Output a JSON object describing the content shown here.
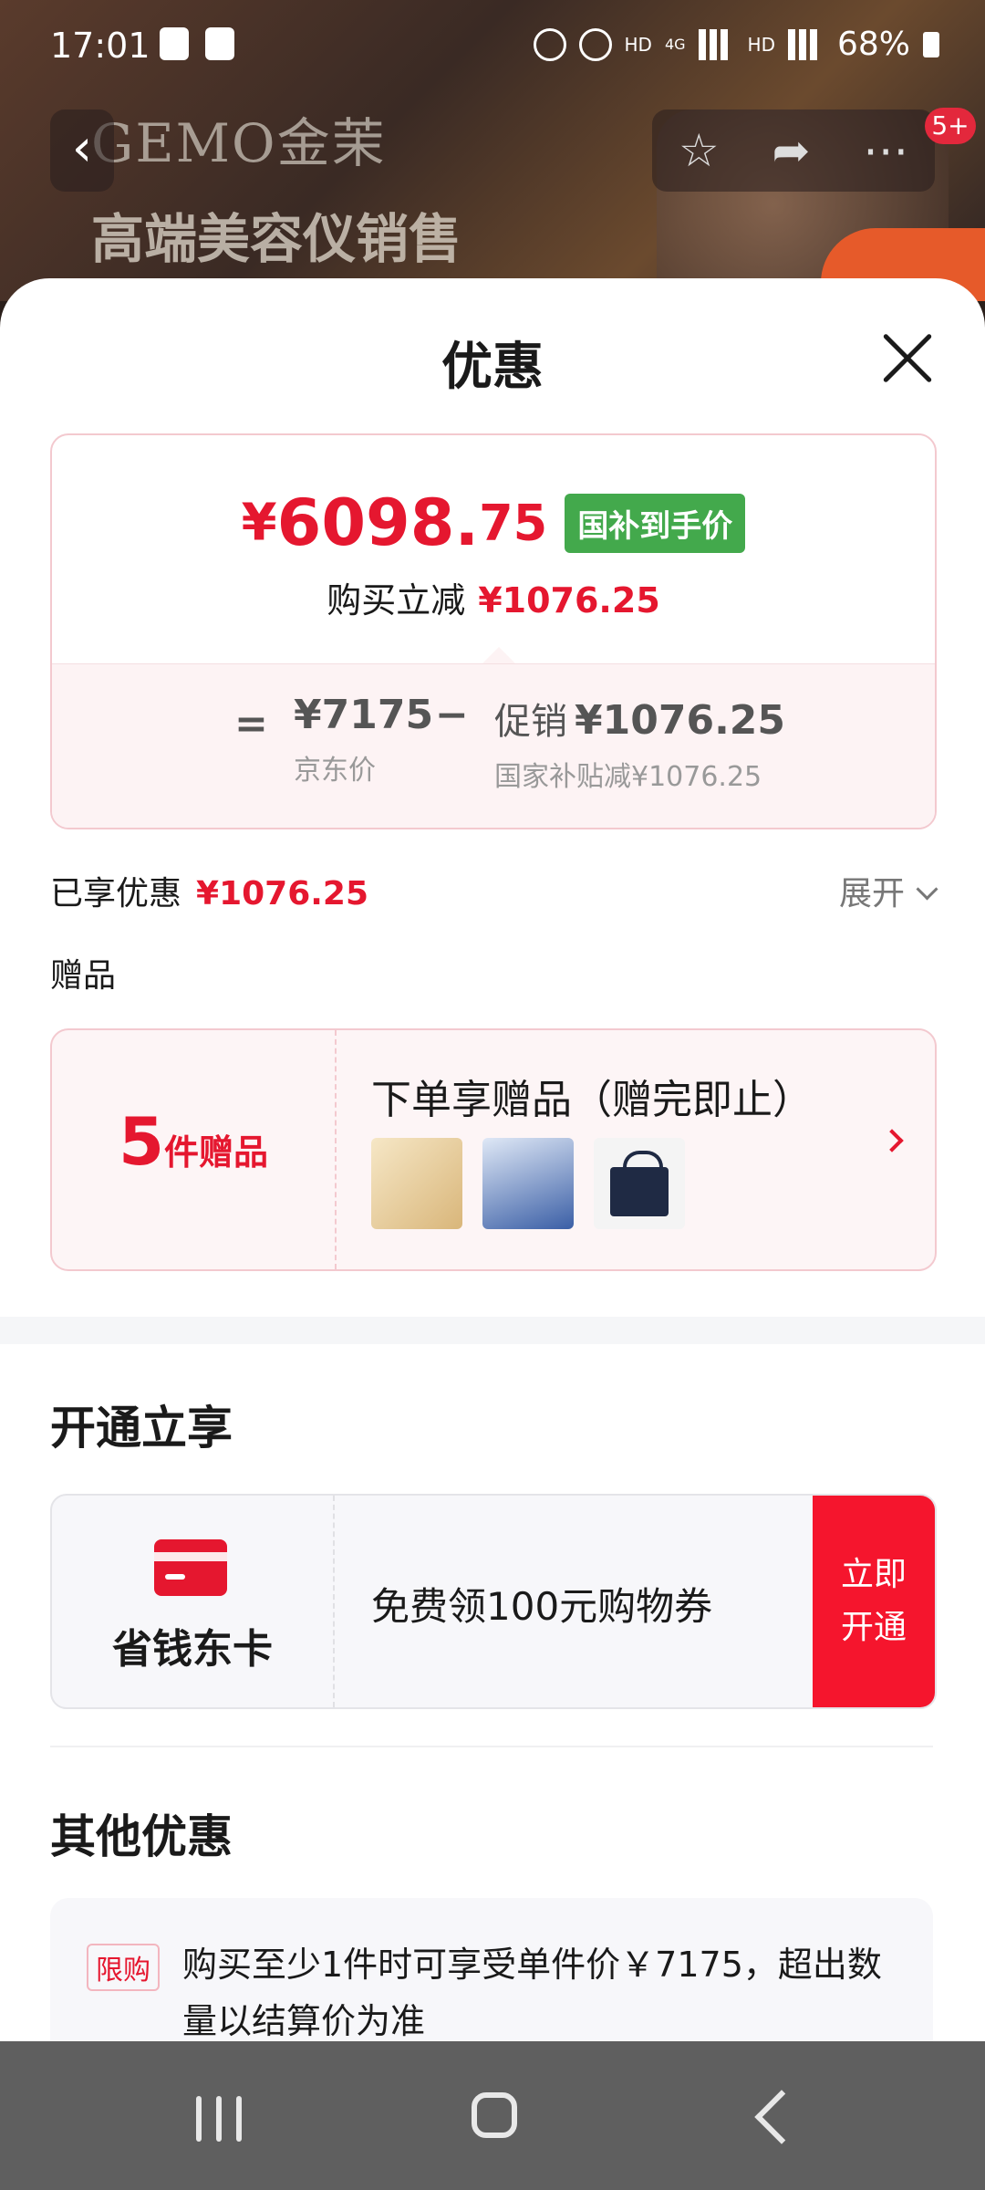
{
  "status_bar": {
    "time": "17:01",
    "net1": "HD",
    "net2": "HD",
    "gen": "4G",
    "battery": "68%"
  },
  "background_page": {
    "brand": "GEMO金茉",
    "subtitle": "高端美容仪销售",
    "badge": "5+"
  },
  "sheet": {
    "title": "优惠"
  },
  "price_card": {
    "currency": "¥",
    "price_int": "6098.",
    "price_dec": "75",
    "tag": "国补到手价",
    "reduce_label": "购买立减",
    "reduce_value": "¥1076.25",
    "equals": "=",
    "base_price": "¥7175",
    "base_label": "京东价",
    "minus": "−",
    "promo_prefix": "促销",
    "promo_value": "¥1076.25",
    "promo_label": "国家补贴减¥1076.25"
  },
  "enjoyed": {
    "label": "已享优惠",
    "value": "¥1076.25",
    "expand": "展开"
  },
  "gifts": {
    "label": "赠品",
    "count": "5",
    "count_unit": "件赠品",
    "title": "下单享赠品（赠完即止）"
  },
  "membership": {
    "section_title": "开通立享",
    "card_name": "省钱东卡",
    "description": "免费领100元购物券",
    "button": "立即开通"
  },
  "other": {
    "section_title": "其他优惠",
    "tag": "限购",
    "text": "购买至少1件时可享受单件价￥7175，超出数量以结算价为准"
  },
  "colors": {
    "accent_red": "#e5172f",
    "tag_green": "#43a94c",
    "nav_bar": "#5f5f5f"
  },
  "icons": [
    "back-icon",
    "star-icon",
    "share-icon",
    "more-icon",
    "close-icon",
    "chevron-down-icon",
    "chevron-right-icon",
    "card-icon",
    "recents-icon",
    "home-icon",
    "nav-back-icon"
  ]
}
